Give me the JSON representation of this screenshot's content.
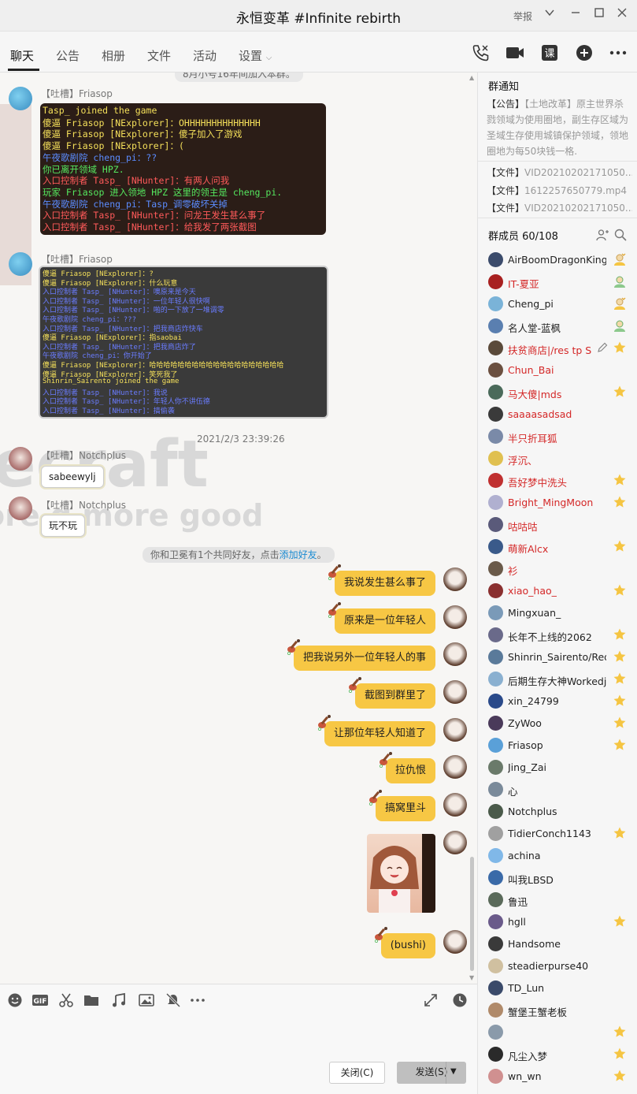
{
  "window": {
    "title": "永恒变革 #Infinite rebirth",
    "report_label": "举报"
  },
  "tabs": [
    "聊天",
    "公告",
    "相册",
    "文件",
    "活动",
    "设置"
  ],
  "toolbar_icons": [
    "phone-icon",
    "video-call-icon",
    "class-icon",
    "add-app-icon",
    "more-icon"
  ],
  "chat": {
    "cut_off_top_text": "8月小号16年间加入本群。",
    "messages": [
      {
        "sender": "【吐槽】Friasop",
        "type": "screenshot",
        "lines": [
          {
            "text": "Tasp_ joined the game",
            "color": "#f5e05a"
          },
          {
            "text": "傻逼 Friasop [NExplorer]：OHHHHHHHHHHHHHH",
            "color": "#f5e05a"
          },
          {
            "text": "傻逼 Friasop [NExplorer]：傻子加入了游戏",
            "color": "#f5e05a"
          },
          {
            "text": "傻逼 Friasop [NExplorer]：(",
            "color": "#f5e05a"
          },
          {
            "text": "午夜歌剧院 cheng_pi：??",
            "color": "#5b8cff"
          },
          {
            "text": "你已离开领域 HPZ.",
            "color": "#55e85f"
          },
          {
            "text": "入口控制者 Tasp_ [NHunter]：有两人问我",
            "color": "#ff5a5a"
          },
          {
            "text": "玩家 Friasop 进入领地 HPZ 这里的领主是 cheng_pi.",
            "color": "#55e85f"
          },
          {
            "text": "午夜歌剧院 cheng_pi：Tasp_调零破坏关掉",
            "color": "#5b8cff"
          },
          {
            "text": "入口控制者 Tasp_ [NHunter]：问龙王发生甚么事了",
            "color": "#ff5a5a"
          },
          {
            "text": "入口控制者 Tasp_ [NHunter]：给我发了两张截图",
            "color": "#ff5a5a"
          }
        ]
      },
      {
        "sender": "【吐槽】Friasop",
        "type": "screenshot",
        "lines": [
          {
            "text": "傻逼 Friasop [NExplorer]：?",
            "color": "#f5e05a"
          },
          {
            "text": "傻逼 Friasop [NExplorer]：什么玩意",
            "color": "#f5e05a"
          },
          {
            "text": "入口控制者 Tasp_ [NHunter]：噢原来是今天",
            "color": "#6a7cff"
          },
          {
            "text": "入口控制者 Tasp_ [NHunter]：一位年轻人很快啊",
            "color": "#6a7cff"
          },
          {
            "text": "入口控制者 Tasp_ [NHunter]：啪的一下放了一堆调零",
            "color": "#6a7cff"
          },
          {
            "text": "午夜歌剧院 cheng_pi：???",
            "color": "#6a7cff"
          },
          {
            "text": "入口控制者 Tasp_ [NHunter]：把我商店炸快车",
            "color": "#6a7cff"
          },
          {
            "text": "傻逼 Friasop [NExplorer]：指saobai",
            "color": "#f5e05a"
          },
          {
            "text": "入口控制者 Tasp_ [NHunter]：把我商店炸了",
            "color": "#6a7cff"
          },
          {
            "text": "午夜歌剧院 cheng_pi：你开始了",
            "color": "#6a7cff"
          },
          {
            "text": "傻逼 Friasop [NExplorer]：哈哈哈哈哈哈哈哈哈哈哈哈哈哈哈哈哈哈哈",
            "color": "#f5e05a"
          },
          {
            "text": "傻逼 Friasop [NExplorer]：笑死我了",
            "color": "#f5e05a"
          },
          {
            "text": "Shinrin_Sairento joined the game",
            "color": "#f5e05a"
          },
          {
            "text": "入口控制者 Tasp_ [NHunter]：我说",
            "color": "#6a7cff"
          },
          {
            "text": "入口控制者 Tasp_ [NHunter]：年轻人你不讲伍德",
            "color": "#6a7cff"
          },
          {
            "text": "入口控制者 Tasp_ [NHunter]：搞偷袭",
            "color": "#6a7cff"
          }
        ]
      }
    ],
    "timestamp": "2021/2/3 23:39:26",
    "left_messages": [
      {
        "sender": "【吐槽】Notchplus",
        "text": "sabeewylj"
      },
      {
        "sender": "【吐槽】Notchplus",
        "text": "玩不玩"
      }
    ],
    "system_note": {
      "text": "你和卫冕有1个共同好友，点击",
      "link": "添加好友",
      "suffix": "。"
    },
    "right_messages": [
      {
        "text": "我说发生甚么事了"
      },
      {
        "text": "原来是一位年轻人"
      },
      {
        "text": "把我说另外一位年轻人的事"
      },
      {
        "text": "截图到群里了"
      },
      {
        "text": "让那位年轻人知道了"
      },
      {
        "text": "拉仇恨"
      },
      {
        "text": "搞窝里斗"
      },
      {
        "text": "[image]"
      },
      {
        "text": "(bushi)"
      }
    ],
    "watermark": [
      "ecraft",
      "ore g more good"
    ]
  },
  "input": {
    "icons": [
      "emoji-icon",
      "gif-icon",
      "scissors-icon",
      "folder-icon",
      "music-icon",
      "image-icon",
      "mute-icon",
      "more-icon"
    ],
    "close_label": "关闭(C)",
    "send_label": "发送(S)"
  },
  "right_panel": {
    "notice_title": "群通知",
    "notice_tag": "【公告】",
    "notice_text": "【土地改革】原主世界杀戮领域为使用圈地，副生存区域为圣域生存使用城镇保护领域，领地圈地为每50块钱一格.",
    "files": [
      {
        "tag": "【文件】",
        "name": "VID20210202171050...."
      },
      {
        "tag": "【文件】",
        "name": "1612257650779.mp4"
      },
      {
        "tag": "【文件】",
        "name": "VID20210202171050...."
      }
    ],
    "members_title": "群成员 60/108",
    "members": [
      {
        "name": "AirBoomDragonKing",
        "color": "#222",
        "badge": "owner",
        "av": "#3b4b6b"
      },
      {
        "name": "IT-夏亚",
        "color": "#d42828",
        "badge": "admin",
        "av": "#a82020"
      },
      {
        "name": "Cheng_pi",
        "color": "#222",
        "badge": "owner",
        "av": "#7ab3d8"
      },
      {
        "name": "名人堂-蓝枫",
        "color": "#222",
        "badge": "admin",
        "av": "#5a7fb0"
      },
      {
        "name": "扶贫商店|/res tp S",
        "color": "#d42828",
        "badge": "star",
        "av": "#5a4a3a"
      },
      {
        "name": "Chun_Bai",
        "color": "#d42828",
        "badge": "",
        "av": "#6b5040"
      },
      {
        "name": "马大傻|mds",
        "color": "#d42828",
        "badge": "star",
        "av": "#4a6a5a"
      },
      {
        "name": "saaaasadsad",
        "color": "#d42828",
        "badge": "",
        "av": "#3a3a3a"
      },
      {
        "name": "半只折耳狐",
        "color": "#d42828",
        "badge": "",
        "av": "#7a8aa8"
      },
      {
        "name": "浮沉、",
        "color": "#d42828",
        "badge": "",
        "av": "#e0c050"
      },
      {
        "name": "吾好梦中洗头",
        "color": "#d42828",
        "badge": "star",
        "av": "#c03030"
      },
      {
        "name": "Bright_MingMoon",
        "color": "#d42828",
        "badge": "star",
        "av": "#b0b0d0"
      },
      {
        "name": "咕咕咕",
        "color": "#d42828",
        "badge": "",
        "av": "#5a5a7a"
      },
      {
        "name": "萌新Alcx",
        "color": "#d42828",
        "badge": "star",
        "av": "#3a5a8a"
      },
      {
        "name": "衫",
        "color": "#d42828",
        "badge": "",
        "av": "#6a5a4a"
      },
      {
        "name": "xiao_hao_",
        "color": "#d42828",
        "badge": "star",
        "av": "#8a3030"
      },
      {
        "name": "Mingxuan_",
        "color": "#222",
        "badge": "",
        "av": "#7a9ab8"
      },
      {
        "name": "长年不上线的2062",
        "color": "#222",
        "badge": "star",
        "av": "#6a6a8a"
      },
      {
        "name": "Shinrin_Sairento/Reda",
        "color": "#222",
        "badge": "star",
        "av": "#5a7a9a"
      },
      {
        "name": "后期生存大神Workedja",
        "color": "#222",
        "badge": "star",
        "av": "#8ab0d0"
      },
      {
        "name": "xin_24799",
        "color": "#222",
        "badge": "star",
        "av": "#2a4a8a"
      },
      {
        "name": "ZyWoo",
        "color": "#222",
        "badge": "star",
        "av": "#4a3a5a"
      },
      {
        "name": "Friasop",
        "color": "#222",
        "badge": "star",
        "av": "#5aa0d8"
      },
      {
        "name": "Jing_Zai",
        "color": "#222",
        "badge": "",
        "av": "#6a7a6a"
      },
      {
        "name": "心",
        "color": "#222",
        "badge": "",
        "av": "#7a8a9a"
      },
      {
        "name": "Notchplus",
        "color": "#222",
        "badge": "",
        "av": "#4a5a4a"
      },
      {
        "name": "TidierConch1143",
        "color": "#222",
        "badge": "star",
        "av": "#a0a0a0"
      },
      {
        "name": "achina",
        "color": "#222",
        "badge": "",
        "av": "#80b8e8"
      },
      {
        "name": "叫我LBSD",
        "color": "#222",
        "badge": "",
        "av": "#3a6aa8"
      },
      {
        "name": "鲁迅",
        "color": "#222",
        "badge": "",
        "av": "#5a6a5a"
      },
      {
        "name": "hgll",
        "color": "#222",
        "badge": "star",
        "av": "#6a5a8a"
      },
      {
        "name": "Handsome",
        "color": "#222",
        "badge": "",
        "av": "#3a3a3a"
      },
      {
        "name": "steadierpurse40",
        "color": "#222",
        "badge": "",
        "av": "#d0c0a0"
      },
      {
        "name": "TD_Lun",
        "color": "#222",
        "badge": "",
        "av": "#3a4a6a"
      },
      {
        "name": "蟹堡王蟹老板",
        "color": "#222",
        "badge": "",
        "av": "#b08a6a"
      },
      {
        "name": "",
        "color": "#222",
        "badge": "star",
        "av": "#8a9aaa"
      },
      {
        "name": "凡尘入梦",
        "color": "#222",
        "badge": "star",
        "av": "#2a2a2a"
      },
      {
        "name": "wn_wn",
        "color": "#222",
        "badge": "star",
        "av": "#d09090"
      }
    ]
  }
}
